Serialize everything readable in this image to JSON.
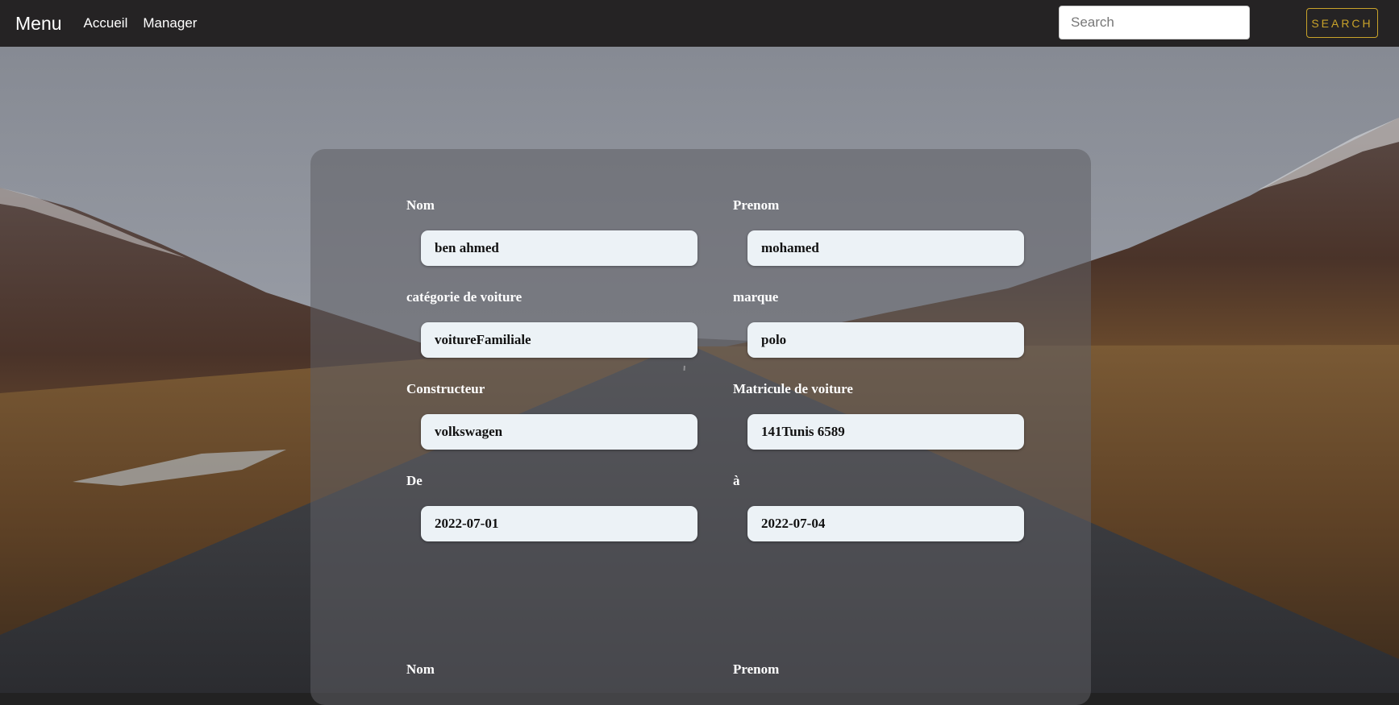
{
  "navbar": {
    "brand": "Menu",
    "links": [
      "Accueil",
      "Manager"
    ],
    "search": {
      "placeholder": "Search",
      "value": ""
    },
    "search_button": "SEARCH"
  },
  "form": {
    "fields": [
      {
        "label": "Nom",
        "value": "ben ahmed"
      },
      {
        "label": "Prenom",
        "value": "mohamed"
      },
      {
        "label": "catégorie de voiture",
        "value": "voitureFamiliale"
      },
      {
        "label": "marque",
        "value": "polo"
      },
      {
        "label": "Constructeur",
        "value": "volkswagen"
      },
      {
        "label": "Matricule de voiture",
        "value": "141Tunis 6589"
      },
      {
        "label": "De",
        "value": "2022-07-01"
      },
      {
        "label": "à",
        "value": "2022-07-04"
      }
    ]
  },
  "next_form": {
    "labels": [
      "Nom",
      "Prenom"
    ]
  },
  "colors": {
    "navbar_bg": "#252324",
    "accent": "#c9a32a",
    "input_bg": "#ecf2f6"
  }
}
